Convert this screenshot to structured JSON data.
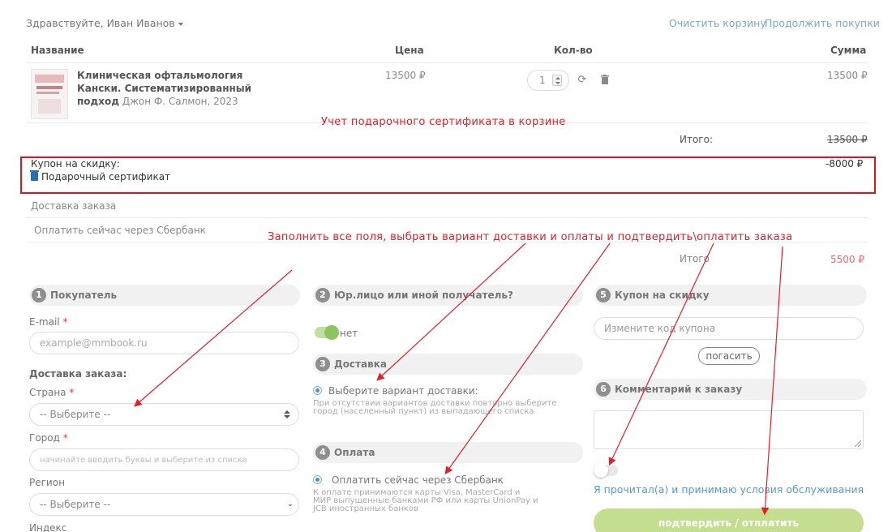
{
  "header": {
    "greeting": "Здравствуйте, Иван Иванов",
    "clear_cart": "Очистить корзину",
    "continue_shopping": "Продолжить покупки"
  },
  "table": {
    "columns": [
      "Название",
      "Цена",
      "Кол-во",
      "Сумма"
    ],
    "item": {
      "title_bold": "Клиническая офтальмология Кански. Систематизированный подход",
      "author": "Джон Ф. Салмон, 2023",
      "price": "13500 ₽",
      "qty": "1",
      "sum": "13500 ₽",
      "refresh_icon": "refresh-icon",
      "delete_icon": "trash-icon"
    },
    "subtotal_label": "Итого:",
    "subtotal_value": "13500 ₽",
    "coupon_label": "Купон на скидку:",
    "certificate": "Подарочный сертификат",
    "discount": "-8000 ₽",
    "delivery_row": "Доставка заказа",
    "payment_row": "Оплатить сейчас через Сбербанк",
    "total_label": "Итого",
    "total_value": "5500 ₽"
  },
  "annotations": {
    "gift_cert": "Учет подарочного сертификата в корзине",
    "fill_all": "Заполнить все поля, выбрать вариант доставки и оплаты и подтвердить\\оплатить заказа"
  },
  "buyer": {
    "num": "1",
    "title": "Покупатель",
    "email_label": "E-mail",
    "email_placeholder": "example@mmbook.ru",
    "delivery_heading": "Доставка заказа:",
    "country_label": "Страна",
    "country_value": "-- Выберите --",
    "city_label": "Город",
    "city_placeholder": "начинайте вводить буквы и выберите из списка",
    "region_label": "Регион",
    "region_value": "-- Выберите --",
    "index_label": "Индекс",
    "required_mark": "*"
  },
  "legal": {
    "num": "2",
    "title": "Юр.лицо или иной получатель?",
    "toggle_label": "нет"
  },
  "delivery": {
    "num": "3",
    "title": "Доставка",
    "option": "Выберите вариант доставки:",
    "note": "При отсутствии вариантов доставки повторно выберите город (населенный пункт) из выпадающего списка"
  },
  "payment": {
    "num": "4",
    "title": "Оплата",
    "option": "Оплатить сейчас через Сбербанк",
    "note": "К оплате принимаются карты Visa, MasterCard и МИР выпущенные банками РФ или карты UnionPay и JCB иностранных банков"
  },
  "coupon": {
    "num": "5",
    "title": "Купон на скидку",
    "placeholder": "Измените код купона",
    "redeem": "погасить"
  },
  "comment": {
    "num": "6",
    "title": "Комментарий к заказу"
  },
  "terms": {
    "link": "Я прочитал(а) и принимаю условия обслуживания"
  },
  "submit": {
    "label": "подтвердить / отплатить"
  },
  "colors": {
    "annotation_red": "#e32028",
    "toggle_on": "#a8d37e",
    "submit_green": "#c5dd8f",
    "link_blue": "#5b98c8"
  }
}
